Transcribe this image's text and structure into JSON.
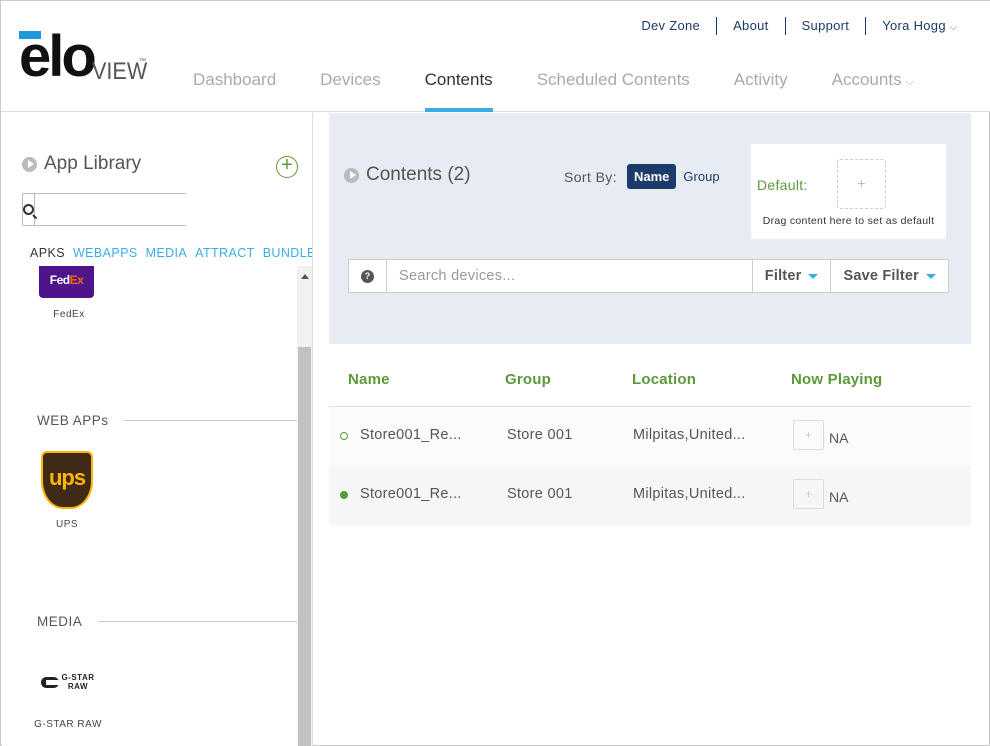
{
  "brand": {
    "logo_text": "elo",
    "logo_sub": "VIEW",
    "accent": "#3aaee4",
    "green": "#5b9a3a",
    "navy": "#1d3b6a"
  },
  "topnav": {
    "dev_zone": "Dev Zone",
    "about": "About",
    "support": "Support",
    "user": "Yora Hogg"
  },
  "mainnav": {
    "tabs": [
      "Dashboard",
      "Devices",
      "Contents",
      "Scheduled Contents",
      "Activity",
      "Accounts"
    ],
    "active": "Contents"
  },
  "sidebar": {
    "title": "App Library",
    "search_placeholder": "",
    "tabs": [
      "APKS",
      "WEBAPPS",
      "MEDIA",
      "ATTRACT",
      "BUNDLE"
    ],
    "active_tab": "APKS",
    "apks": [
      {
        "name": "FedEx"
      }
    ],
    "webapps_heading": "WEB APPs",
    "webapps": [
      {
        "name": "UPS"
      }
    ],
    "media_heading": "MEDIA",
    "media": [
      {
        "name": "G-STAR RAW"
      }
    ]
  },
  "contents": {
    "title": "Contents (2)",
    "sort_label": "Sort By:",
    "sort_options": [
      "Name",
      "Group"
    ],
    "sort_active": "Name",
    "default_label": "Default:",
    "default_hint": "Drag content here to set as default",
    "search_placeholder": "Search devices...",
    "filter_label": "Filter",
    "save_filter_label": "Save Filter"
  },
  "table": {
    "headers": [
      "Name",
      "Group",
      "Location",
      "Now Playing"
    ],
    "rows": [
      {
        "status": "offline",
        "name": "Store001_Re...",
        "group": "Store 001",
        "location": "Milpitas,United...",
        "now_playing": "NA"
      },
      {
        "status": "online",
        "name": "Store001_Re...",
        "group": "Store 001",
        "location": "Milpitas,United...",
        "now_playing": "NA"
      }
    ]
  }
}
